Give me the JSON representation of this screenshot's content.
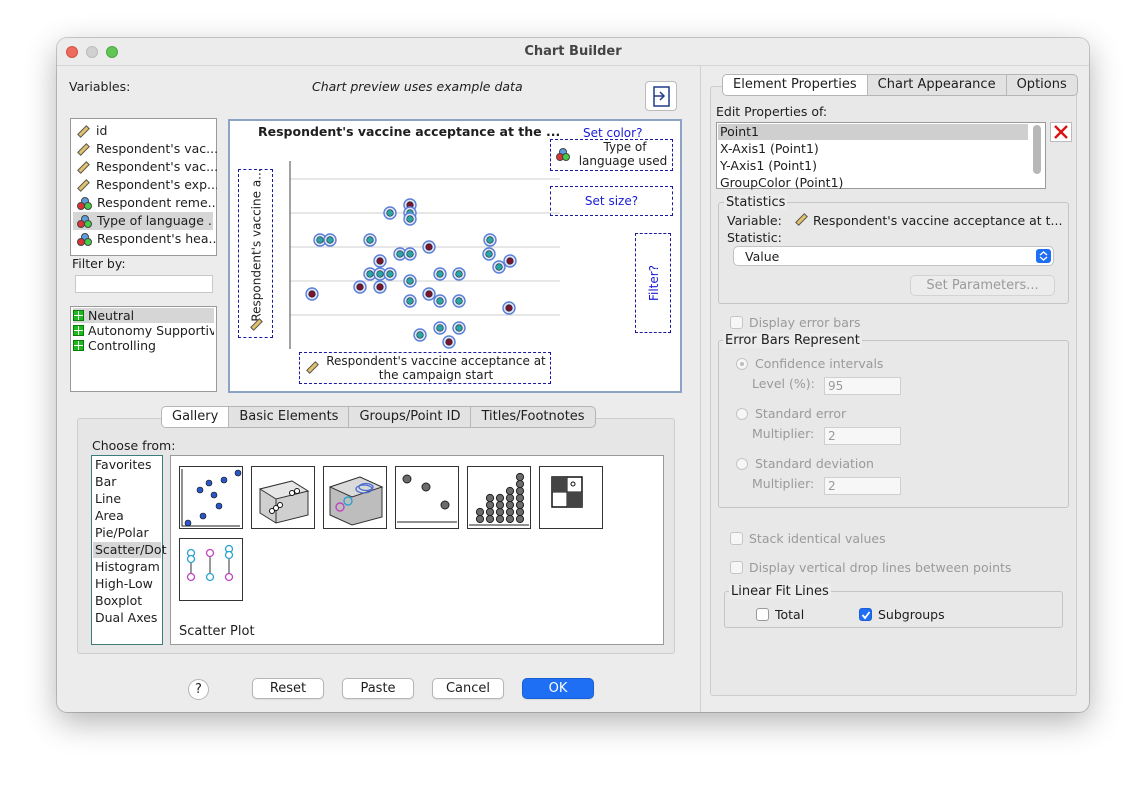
{
  "window": {
    "title": "Chart Builder"
  },
  "left": {
    "variables_label": "Variables:",
    "preview_note": "Chart preview uses example data",
    "variables": [
      {
        "label": "id",
        "icon": "scale-icon"
      },
      {
        "label": "Respondent's vac...",
        "icon": "scale-icon"
      },
      {
        "label": "Respondent's vac...",
        "icon": "scale-icon"
      },
      {
        "label": "Respondent's exp...",
        "icon": "scale-icon"
      },
      {
        "label": "Respondent reme...",
        "icon": "nominal-icon"
      },
      {
        "label": "Type of language ...",
        "icon": "nominal-icon"
      },
      {
        "label": "Respondent's hea...",
        "icon": "nominal-icon"
      }
    ],
    "filter_label": "Filter by:",
    "categories": [
      "Neutral",
      "Autonomy Supportive",
      "Controlling"
    ]
  },
  "canvas": {
    "title": "Respondent's vaccine acceptance at the ...",
    "set_color": "Set color?",
    "color_var_line1": "Type of",
    "color_var_line2": "language used",
    "set_size": "Set size?",
    "filter": "Filter?",
    "y_label": "Respondent's vaccine a...",
    "x_label_line1": "Respondent's vaccine acceptance at",
    "x_label_line2": "the campaign start"
  },
  "gallery": {
    "tabs": [
      "Gallery",
      "Basic Elements",
      "Groups/Point ID",
      "Titles/Footnotes"
    ],
    "choose_from": "Choose from:",
    "types": [
      "Favorites",
      "Bar",
      "Line",
      "Area",
      "Pie/Polar",
      "Scatter/Dot",
      "Histogram",
      "High-Low",
      "Boxplot",
      "Dual Axes"
    ],
    "selected_type": "Scatter/Dot",
    "selected_chart": "Scatter Plot"
  },
  "buttons": {
    "help": "?",
    "reset": "Reset",
    "paste": "Paste",
    "cancel": "Cancel",
    "ok": "OK"
  },
  "right": {
    "tabs": [
      "Element Properties",
      "Chart Appearance",
      "Options"
    ],
    "edit_props_label": "Edit Properties of:",
    "edit_items": [
      "Point1",
      "X-Axis1 (Point1)",
      "Y-Axis1 (Point1)",
      "GroupColor (Point1)"
    ],
    "statistics_title": "Statistics",
    "variable_label": "Variable:",
    "variable_value": "Respondent's vaccine acceptance at t...",
    "statistic_label": "Statistic:",
    "statistic_value": "Value",
    "set_parameters": "Set Parameters...",
    "display_error_bars": "Display error bars",
    "error_bars_title": "Error Bars Represent",
    "confidence_intervals": "Confidence intervals",
    "level_label": "Level (%):",
    "level_value": "95",
    "standard_error": "Standard error",
    "multiplier_label": "Multiplier:",
    "se_multiplier": "2",
    "standard_deviation": "Standard deviation",
    "sd_multiplier": "2",
    "stack_identical": "Stack identical values",
    "drop_lines": "Display vertical drop lines between points",
    "linear_fit_title": "Linear Fit Lines",
    "total": "Total",
    "subgroups": "Subgroups",
    "subgroups_checked": true
  }
}
